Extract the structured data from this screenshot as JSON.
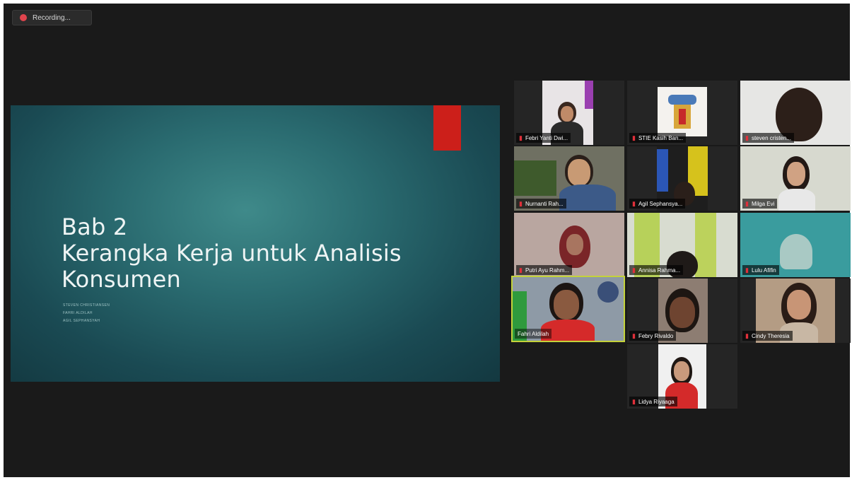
{
  "recording": {
    "label": "Recording..."
  },
  "slide": {
    "title_lines": [
      "Bab 2",
      "Kerangka Kerja untuk Analisis",
      "Konsumen"
    ],
    "authors": [
      "STEVEN CHRISTIANSEN",
      "FAHRI ALDILAH",
      "AGIL SEPHANSYAH"
    ]
  },
  "participants": [
    {
      "name": "Febri Yanti Dwi...",
      "muted": true
    },
    {
      "name": "STIE Kasih Ban...",
      "muted": true
    },
    {
      "name": "steven cristen...",
      "muted": true
    },
    {
      "name": "Nurnanti Rah...",
      "muted": true
    },
    {
      "name": "Agil Sephansya...",
      "muted": true
    },
    {
      "name": "Milga Evi",
      "muted": true
    },
    {
      "name": "Putri Ayu Rahm...",
      "muted": true
    },
    {
      "name": "Annisa Rahma...",
      "muted": true
    },
    {
      "name": "Lulu Afifin",
      "muted": true
    },
    {
      "name": "Fahri Aldilah",
      "muted": false,
      "active_speaker": true
    },
    {
      "name": "Febry Rivaldo",
      "muted": true
    },
    {
      "name": "Cindy Theresia",
      "muted": true
    },
    {
      "name": "Lidya Riyaaga",
      "muted": true
    }
  ],
  "colors": {
    "active_speaker_border": "#c4d23a",
    "muted_icon": "#e0303a",
    "slide_accent": "#cc1f1a"
  },
  "icons": {
    "muted_mic": "muted-mic-icon",
    "recording": "recording-dot-icon"
  }
}
